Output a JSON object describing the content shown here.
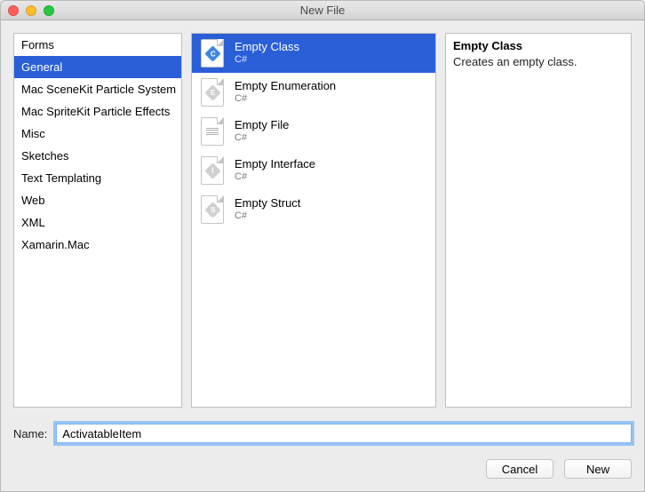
{
  "window": {
    "title": "New File"
  },
  "categories": [
    {
      "label": "Forms",
      "selected": false
    },
    {
      "label": "General",
      "selected": true
    },
    {
      "label": "Mac SceneKit Particle System",
      "selected": false
    },
    {
      "label": "Mac SpriteKit Particle Effects",
      "selected": false
    },
    {
      "label": "Misc",
      "selected": false
    },
    {
      "label": "Sketches",
      "selected": false
    },
    {
      "label": "Text Templating",
      "selected": false
    },
    {
      "label": "Web",
      "selected": false
    },
    {
      "label": "XML",
      "selected": false
    },
    {
      "label": "Xamarin.Mac",
      "selected": false
    }
  ],
  "templates": [
    {
      "label": "Empty Class",
      "sub": "C#",
      "icon": "class-icon",
      "letter": "C",
      "selected": true
    },
    {
      "label": "Empty Enumeration",
      "sub": "C#",
      "icon": "enum-icon",
      "letter": "E",
      "selected": false
    },
    {
      "label": "Empty File",
      "sub": "C#",
      "icon": "file-icon",
      "letter": "",
      "selected": false
    },
    {
      "label": "Empty Interface",
      "sub": "C#",
      "icon": "interface-icon",
      "letter": "I",
      "selected": false
    },
    {
      "label": "Empty Struct",
      "sub": "C#",
      "icon": "struct-icon",
      "letter": "S",
      "selected": false
    }
  ],
  "description": {
    "title": "Empty Class",
    "body": "Creates an empty class."
  },
  "name": {
    "label": "Name:",
    "value": "ActivatableItem"
  },
  "buttons": {
    "cancel": "Cancel",
    "new": "New"
  }
}
